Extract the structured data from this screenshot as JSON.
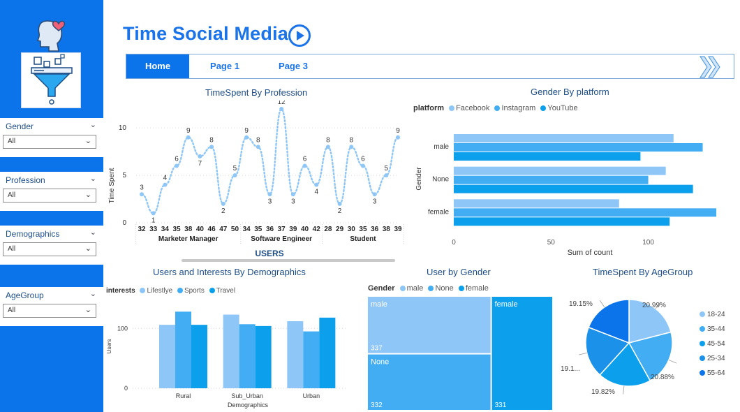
{
  "title": "Time Social Media",
  "nav": {
    "tabs": [
      "Home",
      "Page 1",
      "Page 3"
    ],
    "active": 0
  },
  "slicers": [
    {
      "label": "Gender",
      "value": "All"
    },
    {
      "label": "Profession",
      "value": "All"
    },
    {
      "label": "Demographics",
      "value": "All"
    },
    {
      "label": "AgeGroup",
      "value": "All"
    }
  ],
  "colors": {
    "light": "#8ec6f7",
    "mid": "#42adf3",
    "dark": "#0b9fec",
    "brand": "#0b74ea"
  },
  "chart_data": [
    {
      "id": "timespent_by_profession",
      "type": "line",
      "title": "TimeSpent By Profession",
      "xlabel": "USERS",
      "ylabel": "Time Spent",
      "ylim": [
        0,
        12
      ],
      "yticks": [
        0,
        5,
        10
      ],
      "groups": [
        {
          "name": "Marketer Manager",
          "ages": [
            "32",
            "33",
            "34",
            "35",
            "38",
            "40",
            "46",
            "47",
            "50"
          ],
          "values": [
            3,
            1,
            4,
            6,
            9,
            7,
            8,
            2,
            5
          ]
        },
        {
          "name": "Software Engineer",
          "ages": [
            "34",
            "35",
            "36",
            "37",
            "39",
            "40",
            "42"
          ],
          "values": [
            9,
            8,
            3,
            12,
            3,
            6,
            4
          ]
        },
        {
          "name": "Student",
          "ages": [
            "28",
            "29",
            "30",
            "35",
            "36",
            "38",
            "39"
          ],
          "values": [
            8,
            2,
            8,
            6,
            3,
            5,
            9
          ]
        }
      ],
      "xtick_labels": [
        "32",
        "33",
        "34",
        "35",
        "38",
        "40",
        "46",
        "47",
        "50",
        "34",
        "36",
        "37",
        "39",
        "40",
        "42",
        "28",
        "29",
        "30",
        "35",
        "36",
        "38",
        "39"
      ]
    },
    {
      "id": "gender_by_platform",
      "type": "bar",
      "title": "Gender By platform",
      "legend_title": "platform",
      "series": [
        {
          "name": "Facebook",
          "values": [
            113,
            109,
            85
          ]
        },
        {
          "name": "Instagram",
          "values": [
            128,
            100,
            135
          ]
        },
        {
          "name": "YouTube",
          "values": [
            96,
            123,
            111
          ]
        }
      ],
      "categories": [
        "male",
        "None",
        "female"
      ],
      "xlabel": "Sum of count",
      "ylabel": "Gender",
      "xlim": [
        0,
        140
      ],
      "xticks": [
        0,
        50,
        100
      ]
    },
    {
      "id": "users_interests_demographics",
      "type": "bar",
      "title": "Users and Interests By Demographics",
      "legend_title": "interests",
      "categories": [
        "Rural",
        "Sub_Urban",
        "Urban"
      ],
      "series": [
        {
          "name": "Lifestlye",
          "values": [
            106,
            123,
            112
          ]
        },
        {
          "name": "Sports",
          "values": [
            128,
            107,
            95
          ]
        },
        {
          "name": "Travel",
          "values": [
            106,
            104,
            118
          ]
        }
      ],
      "xlabel": "Demographics",
      "ylabel": "Users",
      "ylim": [
        0,
        140
      ],
      "yticks": [
        0,
        100
      ]
    },
    {
      "id": "user_by_gender",
      "type": "treemap",
      "title": "User by Gender",
      "legend_title": "Gender",
      "categories": [
        "male",
        "None",
        "female"
      ],
      "values": [
        337,
        332,
        331
      ]
    },
    {
      "id": "timespent_by_agegroup",
      "type": "pie",
      "title": "TimeSpent By AgeGroup",
      "categories": [
        "18-24",
        "35-44",
        "45-54",
        "25-34",
        "55-64"
      ],
      "values": [
        20.99,
        20.88,
        19.82,
        19.1,
        19.15
      ],
      "labels": [
        "20.99%",
        "20.88%",
        "19.82%",
        "19.1...",
        "19.15%"
      ]
    }
  ]
}
